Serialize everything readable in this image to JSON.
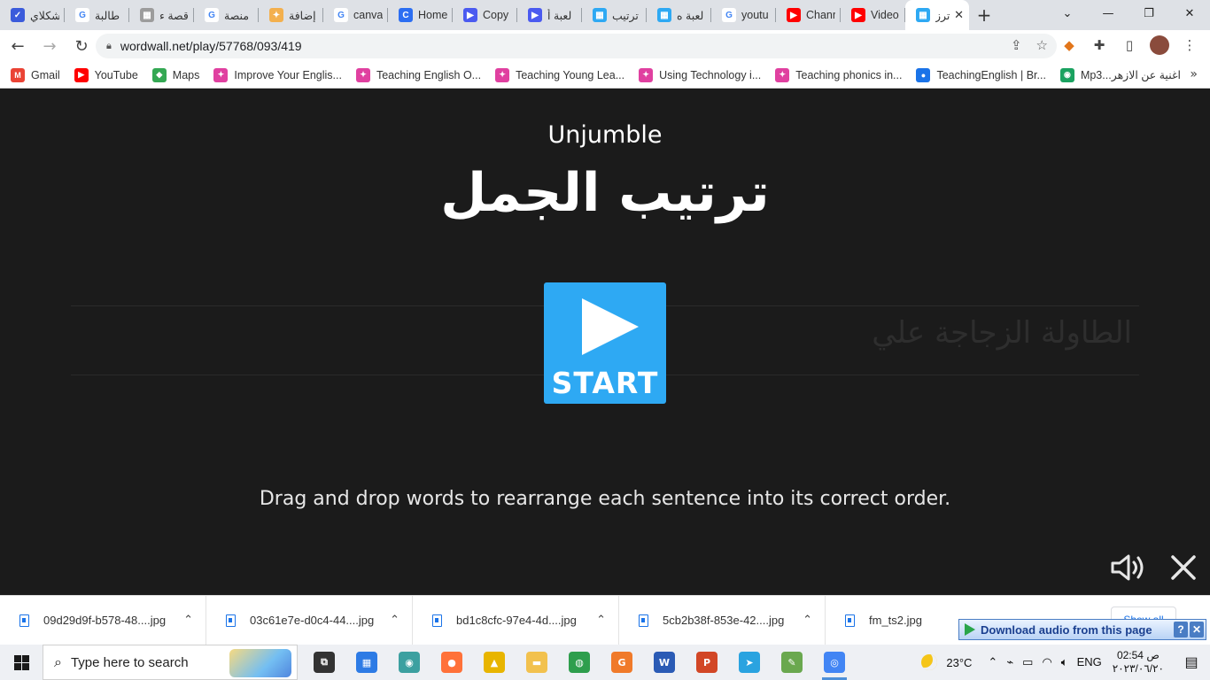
{
  "tabs": [
    {
      "label": "شكلاي",
      "color": "#3b5bdb",
      "glyph": "✓"
    },
    {
      "label": "طالبة",
      "color": "#ffffff",
      "glyph": "G"
    },
    {
      "label": "قصة ء",
      "color": "#9c9c9c",
      "glyph": "▦"
    },
    {
      "label": "منصة",
      "color": "#ffffff",
      "glyph": "G"
    },
    {
      "label": "إضافة",
      "color": "#f3b04e",
      "glyph": "✦"
    },
    {
      "label": "canva",
      "color": "#ffffff",
      "glyph": "G"
    },
    {
      "label": "Home",
      "color": "#2c6ef2",
      "glyph": "C"
    },
    {
      "label": "Copy",
      "color": "#4a5af0",
      "glyph": "▶"
    },
    {
      "label": "لعبة أ",
      "color": "#4a5af0",
      "glyph": "▶"
    },
    {
      "label": "ترتيب",
      "color": "#2ea9f3",
      "glyph": "▦"
    },
    {
      "label": "لعبة ه",
      "color": "#2ea9f3",
      "glyph": "▦"
    },
    {
      "label": "youtu",
      "color": "#ffffff",
      "glyph": "G"
    },
    {
      "label": "Chanr",
      "color": "#ff0000",
      "glyph": "▶"
    },
    {
      "label": "Video",
      "color": "#ff0000",
      "glyph": "▶"
    },
    {
      "label": "ترز",
      "color": "#2ea9f3",
      "glyph": "▦",
      "active": true
    }
  ],
  "toolbar": {
    "url": "wordwall.net/play/57768/093/419"
  },
  "bookmarks": [
    {
      "label": "Gmail",
      "color": "#ea4335",
      "glyph": "M"
    },
    {
      "label": "YouTube",
      "color": "#ff0000",
      "glyph": "▶"
    },
    {
      "label": "Maps",
      "color": "#34a853",
      "glyph": "◆"
    },
    {
      "label": "Improve Your Englis...",
      "color": "#e040a0",
      "glyph": "✦"
    },
    {
      "label": "Teaching English O...",
      "color": "#e040a0",
      "glyph": "✦"
    },
    {
      "label": "Teaching Young Lea...",
      "color": "#e040a0",
      "glyph": "✦"
    },
    {
      "label": "Using Technology i...",
      "color": "#e040a0",
      "glyph": "✦"
    },
    {
      "label": "Teaching phonics in...",
      "color": "#e040a0",
      "glyph": "✦"
    },
    {
      "label": "TeachingEnglish | Br...",
      "color": "#1a73e8",
      "glyph": "●"
    },
    {
      "label": "Mp3...اغنية عن الازهر",
      "color": "#1aa260",
      "glyph": "◉"
    }
  ],
  "game": {
    "type_label": "Unjumble",
    "title": "ترتيب الجمل",
    "background_sentence": "الطاولة  الزجاجة علي",
    "start_label": "START",
    "instructions": "Drag and drop words to rearrange each sentence into its correct order."
  },
  "downloads": {
    "items": [
      "09d29d9f-b578-48....jpg",
      "03c61e7e-d0c4-44....jpg",
      "bd1c8cfc-97e4-4d....jpg",
      "5cb2b38f-853e-42....jpg",
      "fm_ts2.jpg"
    ],
    "show_all": "Show all",
    "audio_banner": "Download audio from this page"
  },
  "taskbar": {
    "search_placeholder": "Type here to search",
    "apps": [
      {
        "name": "task-view",
        "color": "#333333",
        "glyph": "⧉"
      },
      {
        "name": "store",
        "color": "#2d7be5",
        "glyph": "▦"
      },
      {
        "name": "app-circle",
        "color": "#3ca0a0",
        "glyph": "◉"
      },
      {
        "name": "firefox",
        "color": "#ff7139",
        "glyph": "●"
      },
      {
        "name": "app-triangle",
        "color": "#e8b500",
        "glyph": "▲"
      },
      {
        "name": "file-explorer",
        "color": "#f2c14e",
        "glyph": "▬"
      },
      {
        "name": "app-globe",
        "color": "#2e9e4d",
        "glyph": "◍"
      },
      {
        "name": "pdf-app",
        "color": "#f07a2a",
        "glyph": "G"
      },
      {
        "name": "word",
        "color": "#2b5bb5",
        "glyph": "W"
      },
      {
        "name": "powerpoint",
        "color": "#d24726",
        "glyph": "P"
      },
      {
        "name": "telegram",
        "color": "#2aa3e0",
        "glyph": "➤"
      },
      {
        "name": "paint",
        "color": "#6aa84f",
        "glyph": "✎"
      },
      {
        "name": "chrome",
        "color": "#4285f4",
        "glyph": "◎",
        "active": true
      }
    ],
    "weather": "23°C",
    "lang": "ENG",
    "time": "02:54 ص",
    "date": "٢٠٢٣/٠٦/٢٠"
  }
}
